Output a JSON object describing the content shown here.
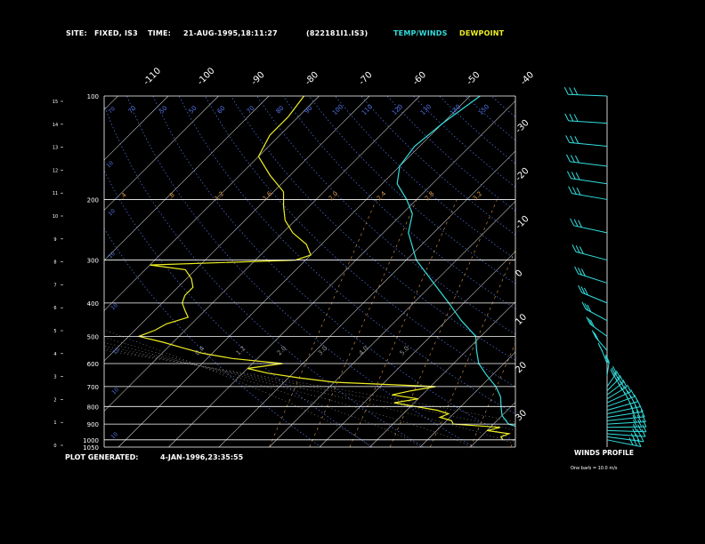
{
  "header": {
    "site_label": "SITE:",
    "site_value": "FIXED, IS3",
    "time_label": "TIME:",
    "time_value": "21-AUG-1995,18:11:27",
    "file_id": "(822181I1.IS3)",
    "legend_temp": "TEMP/WINDS",
    "legend_dew": "DEWPOINT"
  },
  "footer": {
    "plot_generated_label": "PLOT GENERATED:",
    "plot_generated_value": "4-JAN-1996,23:35:55"
  },
  "wind_panel": {
    "title": "WINDS PROFILE",
    "note": "One barb = 10.0 m/s"
  },
  "colors": {
    "background": "#000000",
    "temp": "#33dddd",
    "dewpoint": "#eeee22",
    "isotherm": "#cccccc",
    "dry_adiabat": "#5577ee",
    "mixing_ratio": "#dd9944",
    "moist_adiabat": "#999999",
    "isobar": "#ffffff"
  },
  "chart_data": {
    "type": "line",
    "subtype": "skew-T log-p sounding",
    "pressure_levels": [
      "100",
      "200",
      "300",
      "400",
      "500",
      "600",
      "700",
      "800",
      "900",
      "1000",
      "1050"
    ],
    "height_km_ticks": [
      "0",
      "1",
      "2",
      "3",
      "4",
      "5",
      "6",
      "7",
      "8",
      "9",
      "10",
      "11",
      "12",
      "13",
      "14",
      "15"
    ],
    "temp_ticks_top": [
      "-110",
      "-100",
      "-90",
      "-80",
      "-70",
      "-60",
      "-50",
      "-40"
    ],
    "temp_ticks_right": [
      "-30",
      "-20",
      "-10",
      "0",
      "10",
      "20",
      "30"
    ],
    "dry_adiabat_labels": [
      "70",
      "50",
      "50",
      "60",
      "70",
      "80",
      "90",
      "100",
      "110",
      "120",
      "130",
      "140",
      "150"
    ],
    "mixing_ratio_labels": [
      ".4",
      ".8",
      "1.2",
      "1.6",
      "2.0",
      "2.4",
      "2.8",
      "3.2"
    ],
    "moist_labels": [
      "0.4",
      "1.2",
      "2.0",
      "3.0",
      "4.0",
      "5.0"
    ],
    "temperature_series": {
      "name": "TEMP/WINDS",
      "points": [
        [
          1000,
          28
        ],
        [
          950,
          20
        ],
        [
          900,
          13
        ],
        [
          850,
          10
        ],
        [
          800,
          8
        ],
        [
          750,
          6
        ],
        [
          700,
          3
        ],
        [
          650,
          -1
        ],
        [
          600,
          -5
        ],
        [
          550,
          -8
        ],
        [
          500,
          -11
        ],
        [
          450,
          -17
        ],
        [
          400,
          -23
        ],
        [
          350,
          -30
        ],
        [
          300,
          -38
        ],
        [
          250,
          -45
        ],
        [
          220,
          -48
        ],
        [
          200,
          -52
        ],
        [
          180,
          -57
        ],
        [
          160,
          -60
        ],
        [
          140,
          -61
        ],
        [
          120,
          -60
        ],
        [
          100,
          -58
        ]
      ]
    },
    "dewpoint_series": {
      "name": "DEWPOINT",
      "points": [
        [
          1000,
          15
        ],
        [
          980,
          14
        ],
        [
          960,
          15
        ],
        [
          940,
          10
        ],
        [
          920,
          12
        ],
        [
          900,
          2
        ],
        [
          880,
          1
        ],
        [
          860,
          -2
        ],
        [
          840,
          -1
        ],
        [
          820,
          -4
        ],
        [
          800,
          -9
        ],
        [
          780,
          -14
        ],
        [
          760,
          -10
        ],
        [
          740,
          -16
        ],
        [
          720,
          -13
        ],
        [
          700,
          -9
        ],
        [
          680,
          -30
        ],
        [
          660,
          -38
        ],
        [
          640,
          -45
        ],
        [
          620,
          -50
        ],
        [
          600,
          -44
        ],
        [
          580,
          -55
        ],
        [
          560,
          -62
        ],
        [
          540,
          -67
        ],
        [
          520,
          -72
        ],
        [
          500,
          -78
        ],
        [
          480,
          -76
        ],
        [
          460,
          -75
        ],
        [
          440,
          -72
        ],
        [
          420,
          -74
        ],
        [
          400,
          -76
        ],
        [
          380,
          -77
        ],
        [
          360,
          -77
        ],
        [
          340,
          -79
        ],
        [
          320,
          -82
        ],
        [
          310,
          -90
        ],
        [
          300,
          -62
        ],
        [
          290,
          -60
        ],
        [
          270,
          -63
        ],
        [
          250,
          -68
        ],
        [
          230,
          -72
        ],
        [
          210,
          -75
        ],
        [
          190,
          -78
        ],
        [
          170,
          -84
        ],
        [
          150,
          -90
        ],
        [
          130,
          -92
        ],
        [
          115,
          -92
        ],
        [
          100,
          -93
        ]
      ]
    },
    "winds": [
      [
        1000,
        10.0,
        8
      ],
      [
        980,
        9.5,
        6
      ],
      [
        960,
        9.0,
        4
      ],
      [
        940,
        8.6,
        7
      ],
      [
        920,
        8.2,
        5
      ],
      [
        900,
        7.8,
        6
      ],
      [
        880,
        7.4,
        5
      ],
      [
        860,
        7.0,
        8
      ],
      [
        840,
        6.6,
        7
      ],
      [
        820,
        6.2,
        6
      ],
      [
        800,
        5.8,
        5
      ],
      [
        780,
        5.4,
        7
      ],
      [
        760,
        5.0,
        6
      ],
      [
        740,
        4.7,
        5
      ],
      [
        720,
        4.4,
        4
      ],
      [
        700,
        4.1,
        3
      ],
      [
        650,
        3.5,
        2
      ],
      [
        600,
        2.9,
        2
      ],
      [
        550,
        2.4,
        3
      ],
      [
        500,
        1.9,
        4
      ],
      [
        450,
        1.5,
        4
      ],
      [
        400,
        1.1,
        6
      ],
      [
        350,
        0.7,
        8
      ],
      [
        300,
        0.4,
        7
      ],
      [
        250,
        0.1,
        6
      ],
      [
        200,
        -0.2,
        4
      ],
      [
        180,
        -0.4,
        5
      ],
      [
        160,
        -0.6,
        4
      ],
      [
        140,
        -0.8,
        3
      ],
      [
        120,
        -1.1,
        4
      ],
      [
        100,
        -1.3,
        3
      ]
    ]
  }
}
